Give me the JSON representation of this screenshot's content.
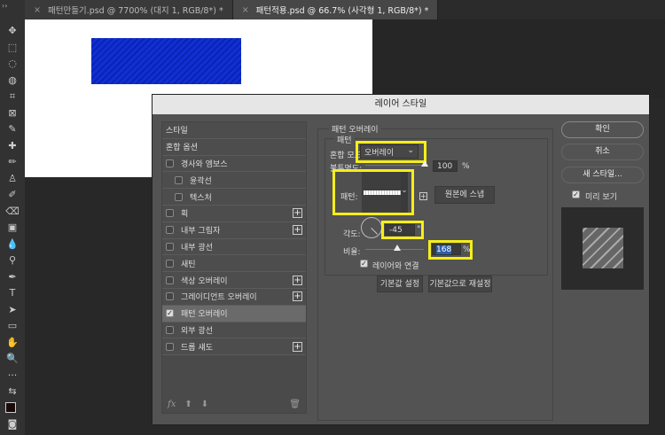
{
  "tabs": [
    {
      "label": "패턴만들기.psd @ 7700% (대지 1, RGB/8*) *",
      "active": false
    },
    {
      "label": "패턴적용.psd @ 66.7% (사각형 1, RGB/8*) *",
      "active": true
    }
  ],
  "dialog": {
    "title": "레이어 스타일",
    "styles": [
      {
        "label": "스타일",
        "checkbox": false,
        "plus": false,
        "indent": false
      },
      {
        "label": "혼합 옵션",
        "checkbox": false,
        "plus": false,
        "indent": false
      },
      {
        "label": "경사와 엠보스",
        "checkbox": true,
        "checked": false,
        "plus": false,
        "indent": false
      },
      {
        "label": "윤곽선",
        "checkbox": true,
        "checked": false,
        "plus": false,
        "indent": true
      },
      {
        "label": "텍스처",
        "checkbox": true,
        "checked": false,
        "plus": false,
        "indent": true
      },
      {
        "label": "획",
        "checkbox": true,
        "checked": false,
        "plus": true,
        "indent": false
      },
      {
        "label": "내부 그림자",
        "checkbox": true,
        "checked": false,
        "plus": true,
        "indent": false
      },
      {
        "label": "내부 광선",
        "checkbox": true,
        "checked": false,
        "plus": false,
        "indent": false
      },
      {
        "label": "새틴",
        "checkbox": true,
        "checked": false,
        "plus": false,
        "indent": false
      },
      {
        "label": "색상 오버레이",
        "checkbox": true,
        "checked": false,
        "plus": true,
        "indent": false
      },
      {
        "label": "그레이디언트 오버레이",
        "checkbox": true,
        "checked": false,
        "plus": true,
        "indent": false
      },
      {
        "label": "패턴 오버레이",
        "checkbox": true,
        "checked": true,
        "plus": false,
        "indent": false,
        "selected": true
      },
      {
        "label": "외부 광선",
        "checkbox": true,
        "checked": false,
        "plus": false,
        "indent": false
      },
      {
        "label": "드롭 섀도",
        "checkbox": true,
        "checked": false,
        "plus": true,
        "indent": false
      }
    ],
    "fx": "fx",
    "section_title": "패턴 오버레이",
    "subsection_title": "패턴",
    "blend_label": "혼합 모드:",
    "blend_value": "오버레이",
    "opacity_label": "불투명도:",
    "opacity_value": "100",
    "percent": "%",
    "pattern_label": "패턴:",
    "snap_button": "원본에 스냅",
    "angle_label": "각도:",
    "angle_value": "-45",
    "degree": "°",
    "scale_label": "비율:",
    "scale_value": "168",
    "link_label": "레이어와 연결",
    "default_set": "기본값 설정",
    "default_reset": "기본값으로 재설정",
    "ok": "확인",
    "cancel": "취소",
    "new_style": "새 스타일...",
    "preview_label": "미리 보기"
  }
}
